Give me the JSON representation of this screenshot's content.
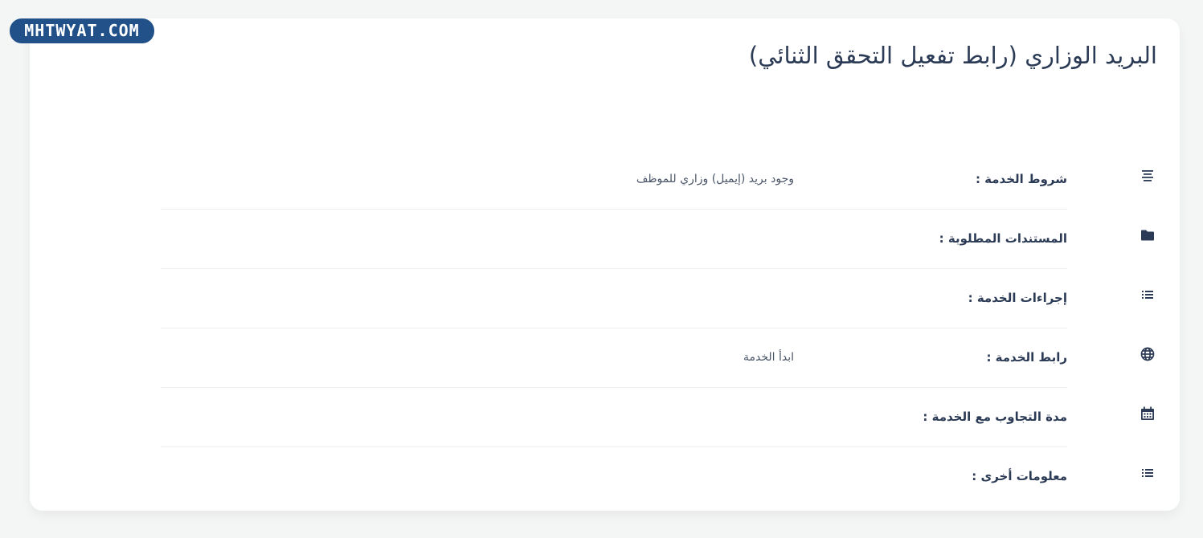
{
  "watermark": "MHTWYAT.COM",
  "page": {
    "title": "البريد الوزاري (رابط تفعيل التحقق الثنائي)"
  },
  "rows": [
    {
      "icon": "align-center-icon",
      "label": "شروط الخدمة :",
      "value": "وجود بريد (إيميل) وزاري للموظف"
    },
    {
      "icon": "folder-icon",
      "label": "المستندات المطلوبة :",
      "value": ""
    },
    {
      "icon": "list-icon",
      "label": "إجراءات الخدمة :",
      "value": ""
    },
    {
      "icon": "globe-icon",
      "label": "رابط الخدمة :",
      "value": "ابدأ الخدمة"
    },
    {
      "icon": "calendar-icon",
      "label": "مدة التجاوب مع الخدمة :",
      "value": ""
    },
    {
      "icon": "list-icon",
      "label": "معلومات أخرى :",
      "value": ""
    }
  ],
  "colors": {
    "text": "#2b3a55",
    "watermark_bg": "#22518a",
    "background": "#f4f5f5"
  }
}
